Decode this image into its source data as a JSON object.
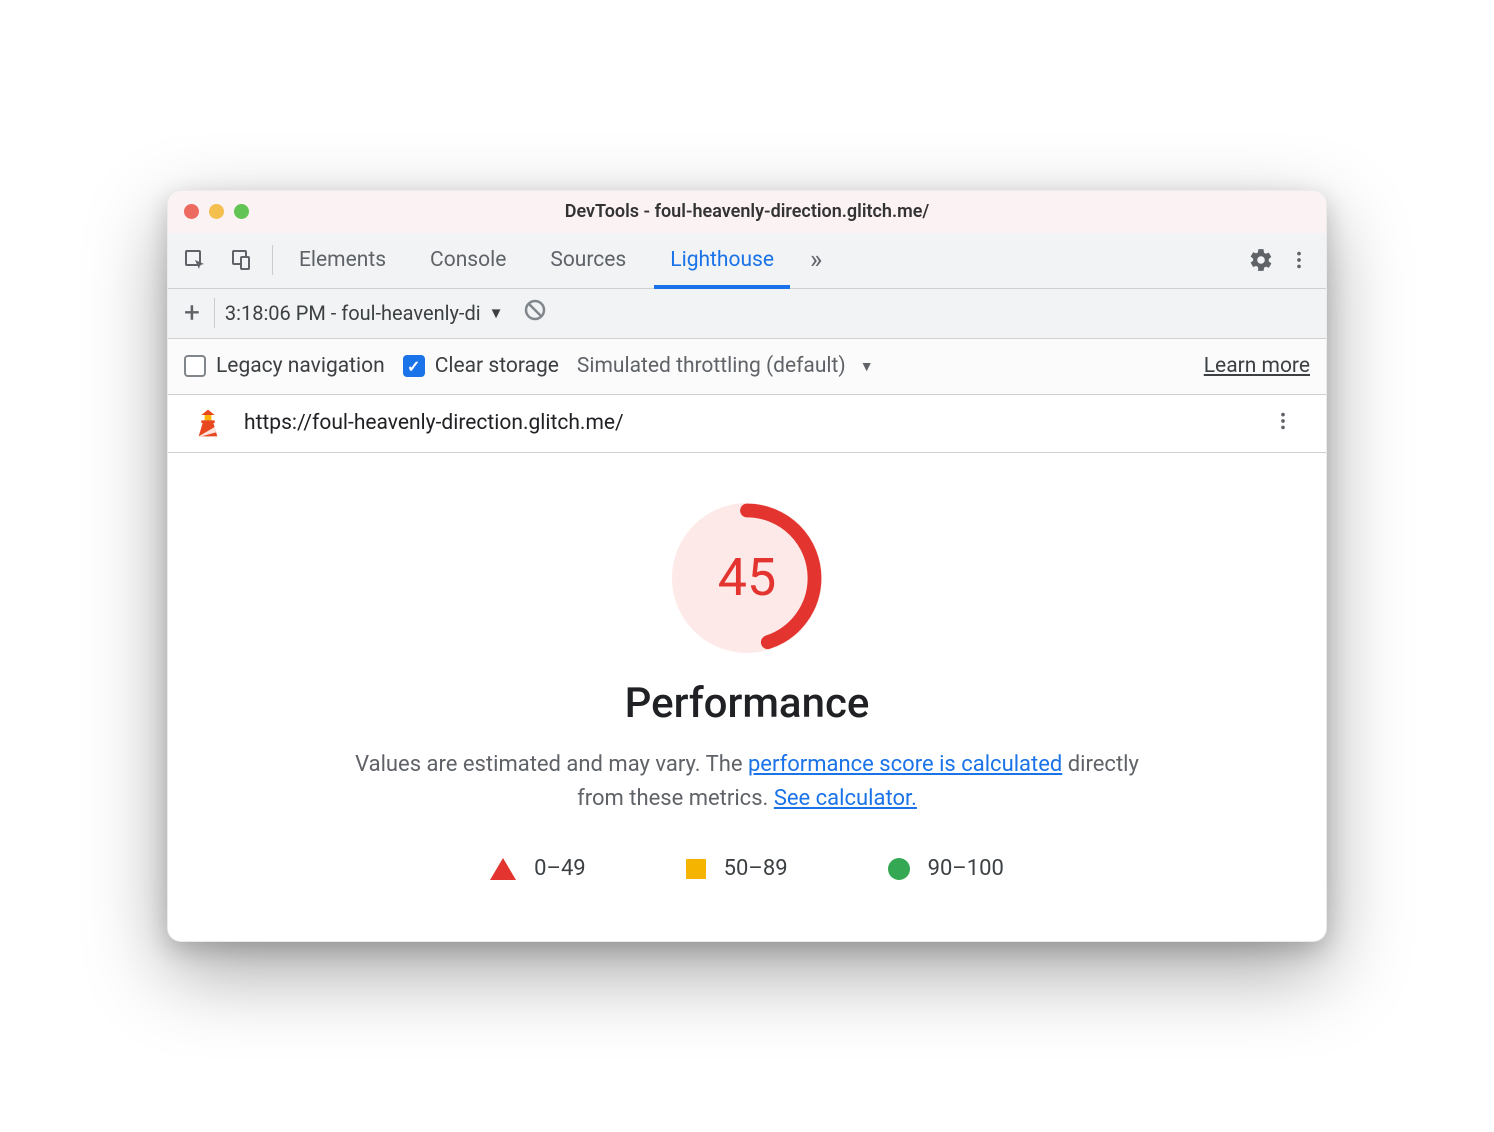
{
  "window": {
    "title": "DevTools - foul-heavenly-direction.glitch.me/"
  },
  "tabs": {
    "items": [
      "Elements",
      "Console",
      "Sources",
      "Lighthouse"
    ],
    "active_index": 3
  },
  "runs": {
    "selected": "3:18:06 PM - foul-heavenly-di"
  },
  "options": {
    "legacy_nav_label": "Legacy navigation",
    "legacy_nav_checked": false,
    "clear_storage_label": "Clear storage",
    "clear_storage_checked": true,
    "throttling_label": "Simulated throttling (default)",
    "learn_more": "Learn more"
  },
  "url": "https://foul-heavenly-direction.glitch.me/",
  "report": {
    "score": "45",
    "title": "Performance",
    "desc_prefix": "Values are estimated and may vary. The ",
    "link1": "performance score is calculated",
    "desc_mid": " directly from these metrics. ",
    "link2": "See calculator.",
    "legend": {
      "fail": "0–49",
      "avg": "50–89",
      "pass": "90–100"
    }
  }
}
